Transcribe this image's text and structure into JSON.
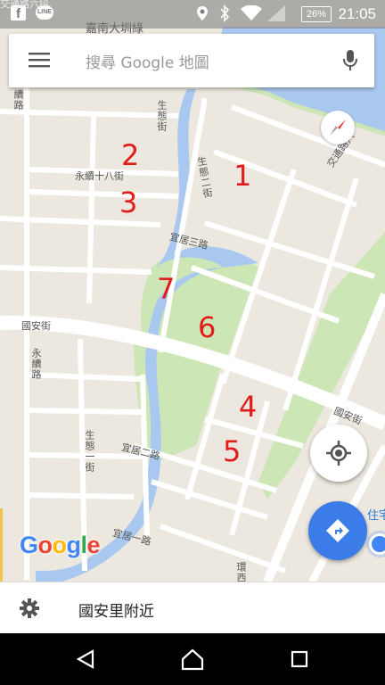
{
  "status_bar": {
    "top_road_label": "交通路六段",
    "battery": "26%",
    "time": "21:05"
  },
  "search": {
    "placeholder": "搜尋 Google 地圖"
  },
  "map": {
    "streets": {
      "jianan_road": "嘉南大圳綠",
      "shengtai_street": "生態街",
      "shengtai_2nd_street": "生態二街",
      "shengtai_1st_street": "生態一街",
      "yongxu_18th_street": "永續十八街",
      "yiju_3rd_road": "宜居三路",
      "yiju_2nd_road": "宜居二路",
      "yiju_1st_road": "宜居一路",
      "guoan_street_left": "國安街",
      "guoan_street_right": "國安街",
      "yongxu_road": "永續路",
      "huanxi_road": "環西路",
      "jiaotong_road": "交通路六",
      "road_left_edge": "續路",
      "right_edge_label": "住宅"
    },
    "markers": [
      "1",
      "2",
      "3",
      "4",
      "5",
      "6",
      "7"
    ],
    "logo": "Google"
  },
  "bottom_sheet": {
    "location_label": "國安里附近"
  },
  "colors": {
    "map_bg": "#ece8df",
    "road": "#ffffff",
    "park": "#cde6b5",
    "water": "#a9c8f0",
    "marker": "#e21b1b",
    "fab_blue": "#3b7ce9"
  }
}
